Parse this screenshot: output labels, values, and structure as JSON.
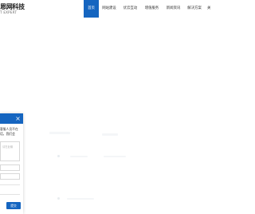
{
  "header": {
    "logo_text": "恩网科技",
    "logo_subtext": "T EXPERT",
    "nav": [
      {
        "label": "首页",
        "active": true
      },
      {
        "label": "网站建设",
        "active": false
      },
      {
        "label": "优云互动",
        "active": false
      },
      {
        "label": "增值服务",
        "active": false
      },
      {
        "label": "新闻资讯",
        "active": false
      },
      {
        "label": "解决方案",
        "active": false
      },
      {
        "label": "关",
        "active": false
      }
    ]
  },
  "chat": {
    "close_icon": "close-icon",
    "message_line1": "客服人员不在",
    "message_line2": "话，我们会",
    "textarea_placeholder": "请在此输",
    "send_label": "提交"
  },
  "colors": {
    "brand_blue": "#1565c0"
  }
}
